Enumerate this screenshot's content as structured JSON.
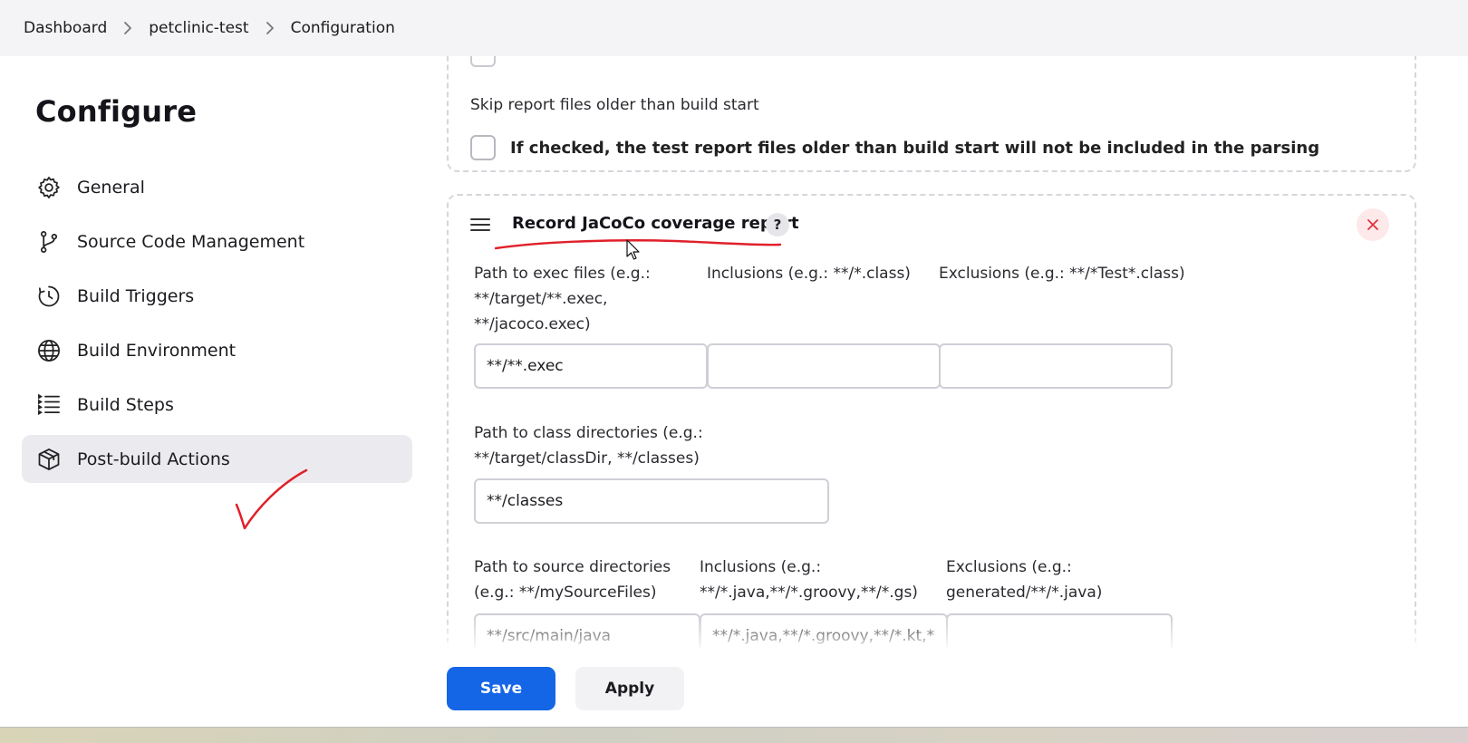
{
  "breadcrumb": {
    "items": [
      "Dashboard",
      "petclinic-test",
      "Configuration"
    ]
  },
  "sidebar": {
    "title": "Configure",
    "items": [
      {
        "label": "General",
        "icon": "gear-icon"
      },
      {
        "label": "Source Code Management",
        "icon": "branch-icon"
      },
      {
        "label": "Build Triggers",
        "icon": "clock-icon"
      },
      {
        "label": "Build Environment",
        "icon": "globe-icon"
      },
      {
        "label": "Build Steps",
        "icon": "list-icon"
      },
      {
        "label": "Post-build Actions",
        "icon": "package-icon"
      }
    ],
    "active_item": "Post-build Actions"
  },
  "junit_section": {
    "skip_label": "Skip report files older than build start",
    "skip_checkbox_text": "If checked, the test report files older than build start will not be included in the parsing"
  },
  "jacoco_section": {
    "title": "Record JaCoCo coverage report",
    "help_label": "?",
    "close_label": "×",
    "exec": {
      "path_label": "Path to exec files (e.g.: **/target/**.exec, **/jacoco.exec)",
      "path_value": "**/**.exec",
      "inclusions_label": "Inclusions (e.g.: **/*.class)",
      "inclusions_value": "",
      "exclusions_label": "Exclusions (e.g.: **/*Test*.class)",
      "exclusions_value": ""
    },
    "classes": {
      "path_label": "Path to class directories (e.g.: **/target/classDir, **/classes)",
      "path_value": "**/classes"
    },
    "sources": {
      "path_label": "Path to source directories (e.g.: **/mySourceFiles)",
      "path_value": "**/src/main/java",
      "inclusions_label": "Inclusions (e.g.: **/*.java,**/*.groovy,**/*.gs)",
      "inclusions_value": "**/*.java,**/*.groovy,**/*.kt,**/*",
      "exclusions_label": "Exclusions (e.g.: generated/**/*.java)",
      "exclusions_value": ""
    }
  },
  "actions": {
    "save_label": "Save",
    "apply_label": "Apply"
  },
  "colors": {
    "primary": "#1466e6",
    "annotation_red": "#e0202a",
    "active_nav_bg": "#ebebef"
  }
}
